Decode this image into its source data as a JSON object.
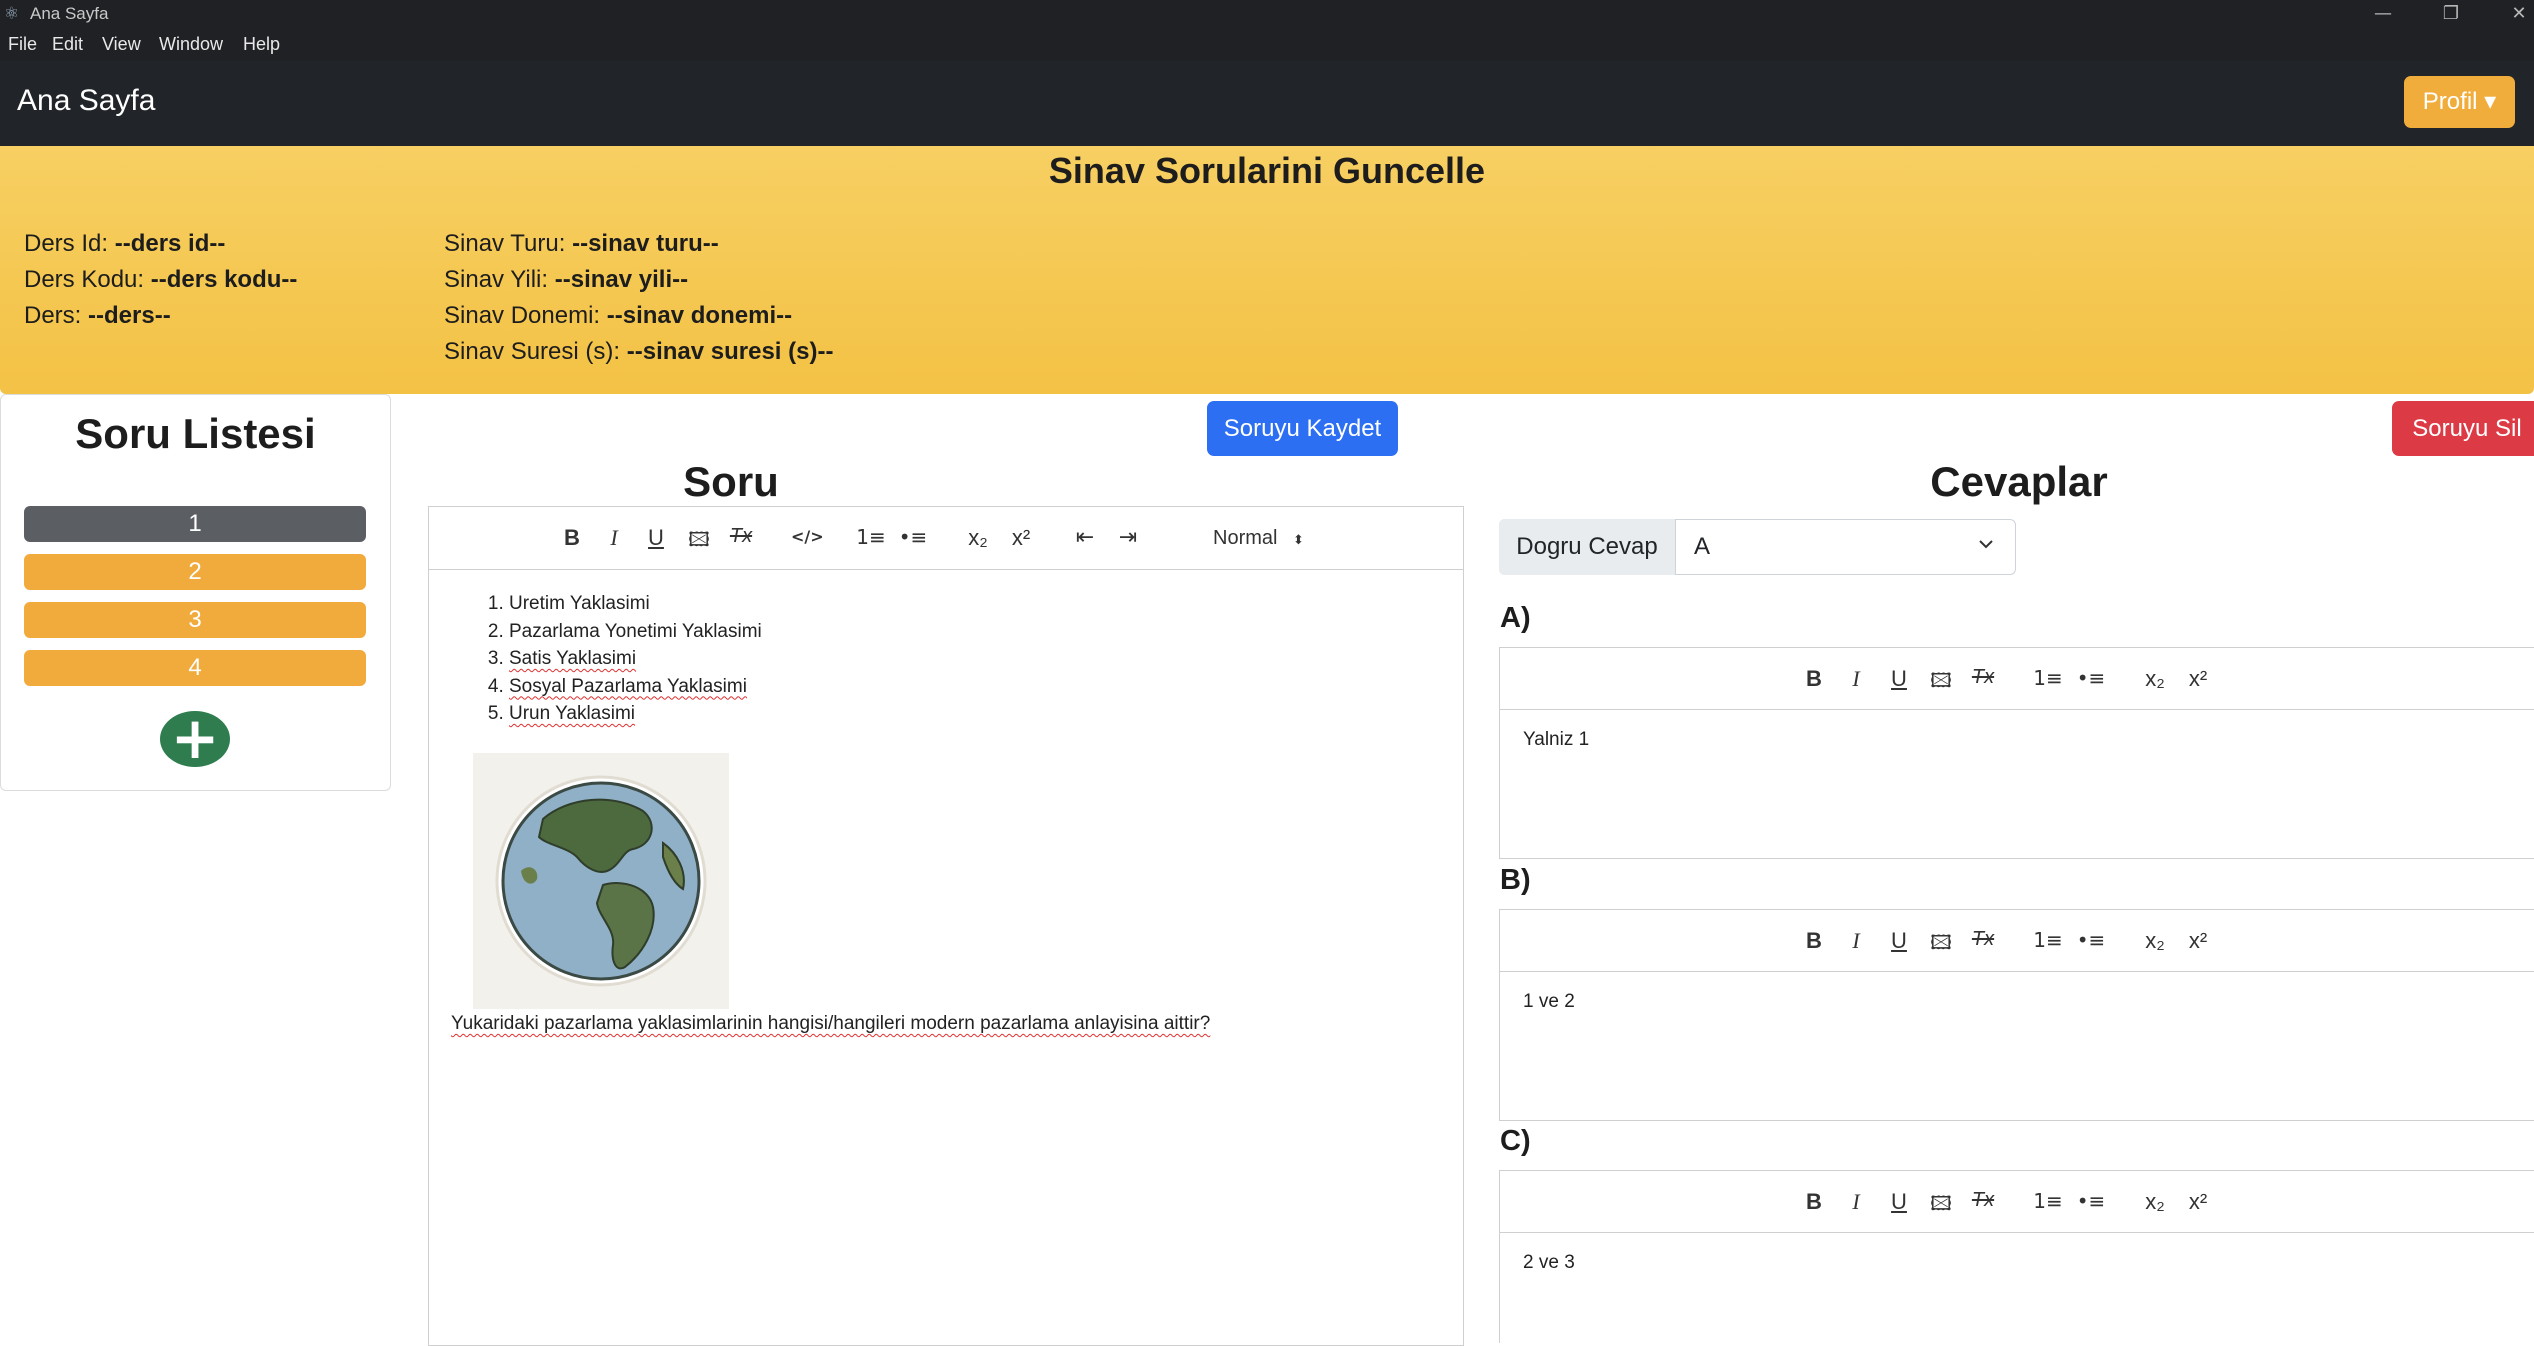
{
  "window": {
    "title": "Ana Sayfa",
    "minimize": "—",
    "restore": "❐",
    "close": "✕"
  },
  "menu": {
    "file": "File",
    "edit": "Edit",
    "view": "View",
    "window": "Window",
    "help": "Help"
  },
  "navbar": {
    "brand": "Ana Sayfa",
    "profile": "Profil ▾"
  },
  "header": {
    "title": "Sinav Sorularini Guncelle",
    "ders_id_label": "Ders Id:",
    "ders_id_value": "--ders id--",
    "ders_kodu_label": "Ders Kodu:",
    "ders_kodu_value": "--ders kodu--",
    "ders_label": "Ders:",
    "ders_value": "--ders--",
    "sinav_turu_label": "Sinav Turu:",
    "sinav_turu_value": "--sinav turu--",
    "sinav_yili_label": "Sinav Yili:",
    "sinav_yili_value": "--sinav yili--",
    "sinav_donemi_label": "Sinav Donemi:",
    "sinav_donemi_value": "--sinav donemi--",
    "sinav_suresi_label": "Sinav Suresi (s):",
    "sinav_suresi_value": "--sinav suresi (s)--"
  },
  "question_list": {
    "title": "Soru Listesi",
    "items": [
      "1",
      "2",
      "3",
      "4"
    ],
    "active_index": 0,
    "add_symbol": "+"
  },
  "actions": {
    "save": "Soruyu Kaydet",
    "delete": "Soruyu Sil"
  },
  "question": {
    "title": "Soru",
    "toolbar": {
      "bold": "B",
      "italic": "I",
      "underline": "U",
      "image": "🖾",
      "clean": "Tx",
      "code": "</>",
      "ordered_list": "1≡",
      "bullet_list": "•≡",
      "subscript": "x₂",
      "superscript": "x²",
      "outdent": "⇤",
      "indent": "⇥",
      "heading_select": "Normal"
    },
    "list_items": [
      "Uretim Yaklasimi",
      "Pazarlama Yonetimi Yaklasimi",
      "Satis Yaklasimi",
      "Sosyal Pazarlama Yaklasimi",
      "Urun Yaklasimi"
    ],
    "image_icon": "globe-image",
    "text": "Yukaridaki pazarlama yaklasimlarinin hangisi/hangileri modern pazarlama anlayisina aittir?"
  },
  "answers": {
    "title": "Cevaplar",
    "correct_label": "Dogru Cevap",
    "correct_value": "A",
    "toolbar": {
      "bold": "B",
      "italic": "I",
      "underline": "U",
      "image": "🖾",
      "clean": "Tx",
      "ordered_list": "1≡",
      "bullet_list": "•≡",
      "subscript": "x₂",
      "superscript": "x²"
    },
    "options": [
      {
        "label": "A)",
        "text": "Yalniz 1"
      },
      {
        "label": "B)",
        "text": "1 ve 2"
      },
      {
        "label": "C)",
        "text": "2 ve 3"
      }
    ]
  }
}
